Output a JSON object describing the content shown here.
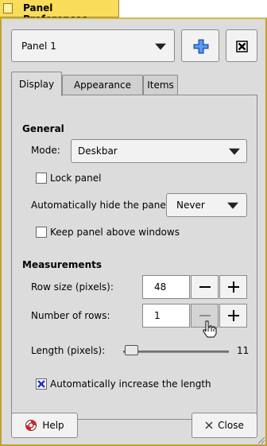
{
  "window": {
    "title": "Panel Preferences"
  },
  "panel_selector": {
    "value": "Panel 1",
    "add_icon": "plus-icon",
    "remove_icon": "close-box-icon"
  },
  "tabs": [
    {
      "label": "Display",
      "active": true
    },
    {
      "label": "Appearance",
      "active": false
    },
    {
      "label": "Items",
      "active": false
    }
  ],
  "general": {
    "heading": "General",
    "mode_label": "Mode:",
    "mode_value": "Deskbar",
    "lock_panel_label": "Lock panel",
    "lock_panel_checked": false,
    "autohide_label": "Automatically hide the panel:",
    "autohide_value": "Never",
    "keep_above_label": "Keep panel above windows",
    "keep_above_checked": false
  },
  "measurements": {
    "heading": "Measurements",
    "row_size_label": "Row size (pixels):",
    "row_size_value": "48",
    "rows_label": "Number of rows:",
    "rows_value": "1",
    "length_label": "Length (pixels):",
    "length_value": "11",
    "length_slider_fraction": 0.0,
    "auto_length_label": "Automatically increase the length",
    "auto_length_checked": true
  },
  "buttons": {
    "help_label": "Help",
    "help_icon": "lifebuoy-icon",
    "close_label": "Close",
    "close_icon": "x-icon"
  },
  "colors": {
    "title_tab": "#f8dc5a",
    "window_bg": "#dcdcdc",
    "add_icon": "#2f6fd6",
    "checkmark": "#1c2fd0"
  }
}
